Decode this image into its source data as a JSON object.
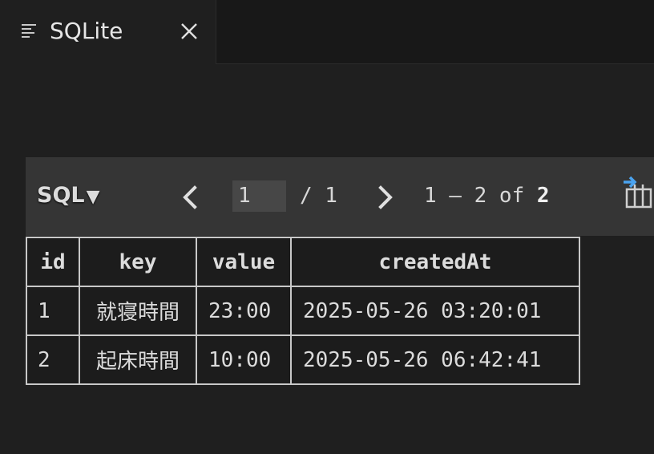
{
  "tab": {
    "title": "SQLite",
    "icon": "preview-lines-icon",
    "close_icon": "close-icon"
  },
  "toolbar": {
    "language": "SQL",
    "language_caret": "▼",
    "page_current": "1",
    "page_total_text": "/ 1",
    "range_text": "1 – 2 of ",
    "range_total": "2",
    "export_icon": "export-columns-icon"
  },
  "table": {
    "columns": [
      "id",
      "key",
      "value",
      "createdAt"
    ],
    "rows": [
      [
        "1",
        "就寝時間",
        "23:00",
        "2025-05-26 03:20:01"
      ],
      [
        "2",
        "起床時間",
        "10:00",
        "2025-05-26 06:42:41"
      ]
    ]
  },
  "colors": {
    "background": "#1f1f1f",
    "toolbar": "#353535",
    "accent_arrow": "#4aa3f0",
    "grid_border": "#c8c8c8"
  }
}
